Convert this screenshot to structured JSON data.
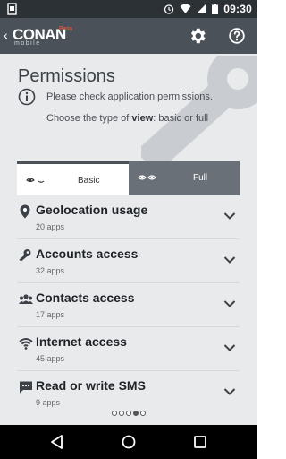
{
  "status_bar": {
    "time": "09:30",
    "icons": [
      "notification-icon",
      "alarm-icon",
      "wifi-icon",
      "signal-icon",
      "battery-icon"
    ]
  },
  "app_bar": {
    "logo_name": "CONAN",
    "logo_sub": "mobile",
    "logo_badge": "Beta",
    "back_glyph": "‹",
    "icons": [
      "settings-gear-icon",
      "help-icon"
    ]
  },
  "page": {
    "title": "Permissions",
    "info_text": "Please check application permissions.",
    "choose_prefix": "Choose the type of ",
    "choose_bold": "view",
    "choose_suffix": ": basic or full"
  },
  "view_toggle": {
    "basic_label": "Basic",
    "full_label": "Full",
    "selected": "Basic"
  },
  "permissions": [
    {
      "title": "Geolocation usage",
      "count": "20 apps",
      "icon": "location-pin-icon"
    },
    {
      "title": "Accounts access",
      "count": "32 apps",
      "icon": "key-icon"
    },
    {
      "title": "Contacts access",
      "count": "17 apps",
      "icon": "contacts-group-icon"
    },
    {
      "title": "Internet access",
      "count": "45 apps",
      "icon": "wifi-icon"
    },
    {
      "title": "Read or write SMS",
      "count": "9 apps",
      "icon": "sms-icon"
    }
  ],
  "pager": {
    "total": 5,
    "active_index": 3
  },
  "nav_bar": {
    "buttons": [
      "back-icon",
      "home-icon",
      "recents-icon"
    ]
  },
  "colors": {
    "status_bar": "#2c3136",
    "app_bar": "#4a5158",
    "content_bg": "#e9eaec",
    "toggle_full_bg": "#6a7077",
    "nav_bar": "#000000"
  }
}
